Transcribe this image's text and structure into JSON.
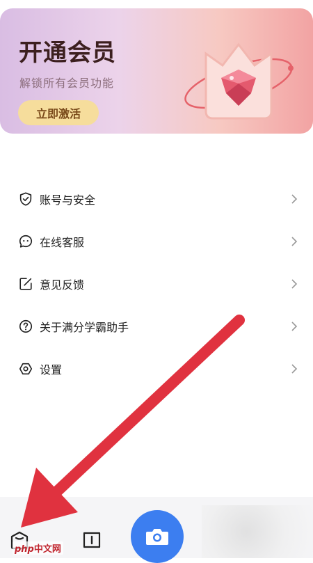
{
  "banner": {
    "title": "开通会员",
    "subtitle": "解锁所有会员功能",
    "cta_label": "立即激活"
  },
  "menu": {
    "items": [
      {
        "label": "账号与安全",
        "icon": "shield-check-icon"
      },
      {
        "label": "在线客服",
        "icon": "chat-face-icon"
      },
      {
        "label": "意见反馈",
        "icon": "edit-icon"
      },
      {
        "label": "关于满分学霸助手",
        "icon": "help-icon"
      },
      {
        "label": "设置",
        "icon": "settings-icon"
      }
    ]
  },
  "tabbar": {
    "items": [
      {
        "icon": "home-icon"
      },
      {
        "icon": "book-icon"
      },
      {
        "icon": "camera-icon"
      }
    ]
  },
  "watermark": {
    "brand": "php",
    "text": "中文网"
  },
  "colors": {
    "accent": "#3c7ef0",
    "cta_bg": "#f6dd9c",
    "arrow": "#e0323f"
  }
}
